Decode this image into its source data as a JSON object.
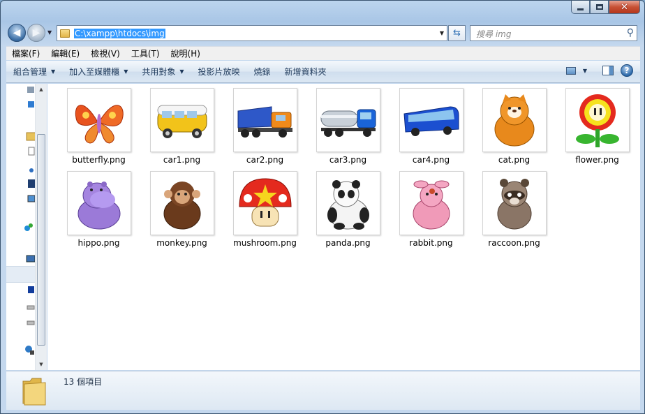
{
  "window": {
    "caption_buttons": [
      "minimize",
      "maximize",
      "close"
    ]
  },
  "nav": {
    "address_path": "C:\\xampp\\htdocs\\img",
    "search_placeholder": "搜尋 img"
  },
  "menu": {
    "items": [
      "檔案(F)",
      "編輯(E)",
      "檢視(V)",
      "工具(T)",
      "說明(H)"
    ]
  },
  "toolbar": {
    "items": [
      {
        "label": "組合管理",
        "dropdown": true
      },
      {
        "label": "加入至媒體櫃",
        "dropdown": true
      },
      {
        "label": "共用對象",
        "dropdown": true
      },
      {
        "label": "投影片放映",
        "dropdown": false
      },
      {
        "label": "燒錄",
        "dropdown": false
      },
      {
        "label": "新增資料夾",
        "dropdown": false
      }
    ]
  },
  "files": [
    {
      "name": "butterfly.png",
      "icon": "butterfly"
    },
    {
      "name": "car1.png",
      "icon": "van"
    },
    {
      "name": "car2.png",
      "icon": "dump-truck"
    },
    {
      "name": "car3.png",
      "icon": "tanker-truck"
    },
    {
      "name": "car4.png",
      "icon": "bus"
    },
    {
      "name": "cat.png",
      "icon": "cat"
    },
    {
      "name": "flower.png",
      "icon": "flower"
    },
    {
      "name": "hippo.png",
      "icon": "hippo"
    },
    {
      "name": "monkey.png",
      "icon": "monkey"
    },
    {
      "name": "mushroom.png",
      "icon": "mushroom"
    },
    {
      "name": "panda.png",
      "icon": "panda"
    },
    {
      "name": "rabbit.png",
      "icon": "rabbit"
    },
    {
      "name": "raccoon.png",
      "icon": "raccoon"
    }
  ],
  "details": {
    "item_count": "13 個項目"
  },
  "colors": {
    "selection": "#3399ff",
    "toolbar_text": "#1e395b"
  }
}
